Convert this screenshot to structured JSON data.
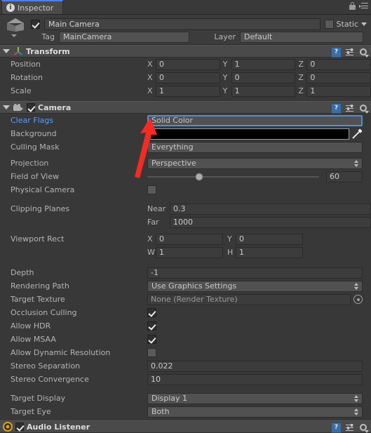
{
  "window": {
    "tab_label": "Inspector",
    "tab_icon": "info-icon",
    "lock_icon": "lock-icon",
    "menu_icon": "hamburger-menu-icon"
  },
  "gameobject": {
    "icon": "cube-icon",
    "enabled": true,
    "name": "Main Camera",
    "static_label": "Static",
    "static_checked": false,
    "tag_label": "Tag",
    "tag_value": "MainCamera",
    "layer_label": "Layer",
    "layer_value": "Default"
  },
  "components": [
    {
      "name": "Transform",
      "icon": "transform-axis-icon",
      "expanded": true,
      "has_checkbox": false,
      "properties": [
        {
          "label": "Position",
          "type": "vector3",
          "axes": [
            "X",
            "Y",
            "Z"
          ],
          "values": [
            "0",
            "1",
            "0"
          ]
        },
        {
          "label": "Rotation",
          "type": "vector3",
          "axes": [
            "X",
            "Y",
            "Z"
          ],
          "values": [
            "0",
            "0",
            "0"
          ]
        },
        {
          "label": "Scale",
          "type": "vector3",
          "axes": [
            "X",
            "Y",
            "Z"
          ],
          "values": [
            "1",
            "1",
            "1"
          ]
        }
      ]
    },
    {
      "name": "Camera",
      "icon": "movie-camera-icon",
      "expanded": true,
      "has_checkbox": true,
      "enabled": true,
      "properties": [
        {
          "label": "Clear Flags",
          "type": "popup",
          "value": "Solid Color",
          "highlighted": true,
          "focused": true
        },
        {
          "label": "Background",
          "type": "color",
          "value": "#000000",
          "picker_icon": "eyedropper-icon"
        },
        {
          "label": "Culling Mask",
          "type": "popup",
          "value": "Everything"
        },
        {
          "label": "Projection",
          "type": "popup",
          "value": "Perspective"
        },
        {
          "label": "Field of View",
          "type": "slider",
          "value": "60",
          "slider_percent": 30
        },
        {
          "label": "Physical Camera",
          "type": "checkbox",
          "checked": false
        },
        {
          "label": "Clipping Planes",
          "type": "pair",
          "sub_labels": [
            "Near",
            "Far"
          ],
          "values": [
            "0.3",
            "1000"
          ]
        },
        {
          "label": "Viewport Rect",
          "type": "rect",
          "axes": [
            "X",
            "Y",
            "W",
            "H"
          ],
          "values": [
            "0",
            "0",
            "1",
            "1"
          ]
        },
        {
          "label": "Depth",
          "type": "text",
          "value": "-1"
        },
        {
          "label": "Rendering Path",
          "type": "popup",
          "value": "Use Graphics Settings"
        },
        {
          "label": "Target Texture",
          "type": "object",
          "value": "None (Render Texture)",
          "picker_icon": "object-picker-icon"
        },
        {
          "label": "Occlusion Culling",
          "type": "checkbox",
          "checked": true
        },
        {
          "label": "Allow HDR",
          "type": "checkbox",
          "checked": true
        },
        {
          "label": "Allow MSAA",
          "type": "checkbox",
          "checked": true
        },
        {
          "label": "Allow Dynamic Resolution",
          "type": "checkbox",
          "checked": false
        },
        {
          "label": "Stereo Separation",
          "type": "text",
          "value": "0.022"
        },
        {
          "label": "Stereo Convergence",
          "type": "text",
          "value": "10"
        },
        {
          "label": "Target Display",
          "type": "popup",
          "value": "Display 1"
        },
        {
          "label": "Target Eye",
          "type": "popup",
          "value": "Both"
        }
      ]
    },
    {
      "name": "Audio Listener",
      "icon": "audio-listener-icon",
      "expanded": false,
      "has_checkbox": true,
      "enabled": true,
      "properties": []
    }
  ],
  "component_header_icons": {
    "help": "?",
    "preset": "preset-icon",
    "settings": "gear-icon"
  },
  "annotation": {
    "type": "red-arrow",
    "color": "#f42b22",
    "points_to": "Clear Flags dropdown"
  }
}
